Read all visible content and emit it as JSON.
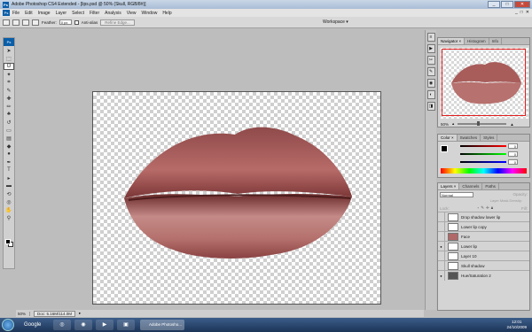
{
  "window": {
    "title": "Adobe Photoshop CS4 Extended - [lips.psd @ 50% (Skull, RGB/8#)]",
    "app_badge": "Ps"
  },
  "menu": [
    "File",
    "Edit",
    "Image",
    "Layer",
    "Select",
    "Filter",
    "Analysis",
    "View",
    "Window",
    "Help"
  ],
  "window_controls": [
    "_",
    "□",
    "✕"
  ],
  "options": {
    "feather_label": "Feather:",
    "feather_value": "0 px",
    "antialias_label": "Anti-alias",
    "refine_label": "Refine Edge...",
    "workspace_label": "Workspace ▾"
  },
  "status": {
    "zoom": "50%",
    "doc": "Doc: 5.16M/114.0M"
  },
  "navigator": {
    "tabs": [
      "Navigator ×",
      "Histogram",
      "Info"
    ],
    "zoom": "50%"
  },
  "color": {
    "tabs": [
      "Color ×",
      "Swatches",
      "Styles"
    ],
    "r": "0",
    "g": "0",
    "b": "0"
  },
  "layers": {
    "tabs": [
      "Layers ×",
      "Channels",
      "Paths"
    ],
    "mode": "Normal",
    "opacity_label": "Opacity:",
    "mask_density": "Layer Mask Density:",
    "lock_label": "Lock:",
    "fill_label": "Fill:",
    "rows": [
      "Drop shadow lower lip",
      "Lower lip copy",
      "Face",
      "Lower lip",
      "Layer 10",
      "Skull shadow",
      "Hue/Saturation 2"
    ]
  },
  "taskbar": {
    "google": "Google",
    "ps_task": "Adobe Photosho...",
    "time": "12:01",
    "date": "24/10/2009"
  },
  "colors": {
    "accent": "#0a5ea8",
    "nav_box": "#e02020"
  }
}
